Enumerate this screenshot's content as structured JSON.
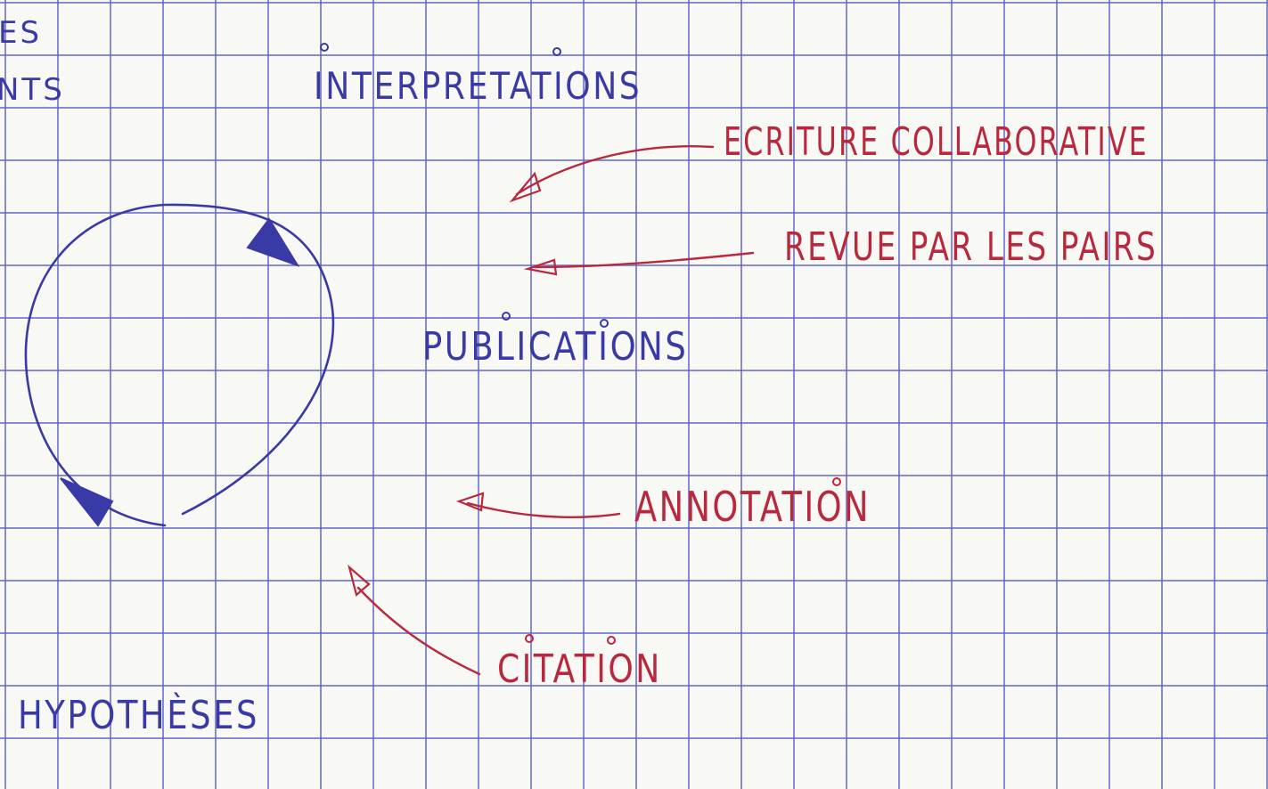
{
  "colors": {
    "paper": "#f8f8f5",
    "grid": "#5c60c8",
    "blue_ink": "#3a3aa6",
    "red_ink": "#b8283e"
  },
  "labels": {
    "fragment_top": "ES",
    "fragment_second": "NTS",
    "interpretations": "INTERPRETATIONS",
    "publications": "PUBLICATIONS",
    "hypotheses": "HYPOTHÈSES"
  },
  "red_labels": {
    "ecriture": "ECRITURE COLLABORATIVE",
    "revue": "REVUE PAR LES PAIRS",
    "annotation": "ANNOTATION",
    "citation": "CITATION"
  }
}
